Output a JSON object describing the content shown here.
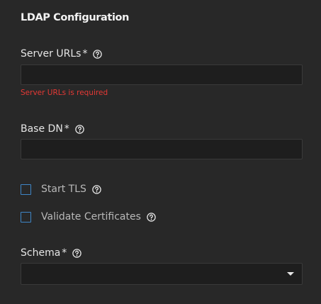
{
  "section": {
    "title": "LDAP Configuration"
  },
  "fields": {
    "server_urls": {
      "label": "Server URLs",
      "required_mark": "*",
      "value": "",
      "error": "Server URLs is required"
    },
    "base_dn": {
      "label": "Base DN",
      "required_mark": "*",
      "value": ""
    },
    "start_tls": {
      "label": "Start TLS",
      "checked": false
    },
    "validate_certificates": {
      "label": "Validate Certificates",
      "checked": false
    },
    "schema": {
      "label": "Schema",
      "required_mark": "*",
      "selected": ""
    }
  },
  "icons": {
    "help": "help-circle-icon",
    "dropdown": "caret-down-icon"
  },
  "colors": {
    "background": "#282828",
    "input_background": "#1e1e1e",
    "error": "#e53935",
    "checkbox_border": "#3f86c7"
  }
}
